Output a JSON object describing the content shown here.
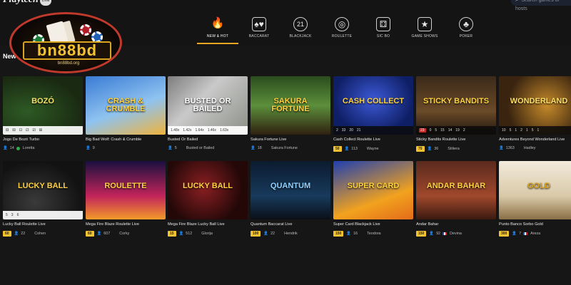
{
  "brand": {
    "name": "Playtech",
    "badge": "LIVE"
  },
  "search": {
    "placeholder": "Search games or hosts"
  },
  "logo": {
    "word": "bn88bd",
    "sub": "bn88bd.org"
  },
  "categories": [
    {
      "label": "NEW & HOT",
      "icon": "flame-icon",
      "glyph": "🔥",
      "active": true
    },
    {
      "label": "BACCARAT",
      "icon": "cards-icon",
      "glyph": "♠♥"
    },
    {
      "label": "BLACKJACK",
      "icon": "blackjack-21-icon",
      "glyph": "21"
    },
    {
      "label": "ROULETTE",
      "icon": "roulette-icon",
      "glyph": "◎"
    },
    {
      "label": "SIC BO",
      "icon": "dice-icon",
      "glyph": "⚃"
    },
    {
      "label": "GAME SHOWS",
      "icon": "game-show-icon",
      "glyph": "★"
    },
    {
      "label": "POKER",
      "icon": "poker-chip-icon",
      "glyph": "♣"
    }
  ],
  "section_title": "New",
  "row1": [
    {
      "title": "Jogo De Bozó Turbo",
      "bet": "",
      "players": "14",
      "flag": "br",
      "host": "Loretta",
      "art": "BOZÓ",
      "hist": [
        "⚃",
        "⚄",
        "⚀",
        "⚁",
        "⚂",
        "⚅"
      ]
    },
    {
      "title": "Big Bad Wolf: Crash & Crumble",
      "bet": "",
      "players": "9",
      "flag": "",
      "host": "",
      "art": "CRASH & CRUMBLE",
      "hist": []
    },
    {
      "title": "Busted Or Bailed",
      "bet": "",
      "players": "5",
      "flag": "",
      "host": "Busted or Bailed",
      "art": "BUSTED OR BAILED",
      "hist": [
        "1.48x",
        "1.42x",
        "1.64x",
        "1.46x",
        "1.63x"
      ]
    },
    {
      "title": "Sakura Fortune Live",
      "bet": "",
      "players": "18",
      "flag": "",
      "host": "Sakura Fortune",
      "art": "SAKURA FORTUNE",
      "hist": []
    },
    {
      "title": "Cash Collect Roulette Live",
      "bet": "50",
      "players": "113",
      "flag": "",
      "host": "Wayne",
      "art": "CASH COLLECT",
      "hist": [
        "2",
        "33",
        "20",
        "21"
      ]
    },
    {
      "title": "Sticky Bandits Roulette Live",
      "bet": "70",
      "players": "36",
      "flag": "",
      "host": "Stiliera",
      "art": "STICKY BANDITS",
      "hist": [
        "23",
        "0",
        "5",
        "15",
        "14",
        "19",
        "2"
      ]
    },
    {
      "title": "Adventures Beyond Wonderland Live",
      "bet": "",
      "players": "1363",
      "flag": "",
      "host": "Hadley",
      "art": "WONDERLAND",
      "hist": [
        "10",
        "5",
        "1",
        "2",
        "1",
        "5",
        "1"
      ]
    }
  ],
  "row2": [
    {
      "title": "Lucky Ball Roulette Live",
      "bet": "60",
      "players": "22",
      "flag": "",
      "host": "Cohen",
      "art": "LUCKY BALL",
      "hist": [
        "5",
        "3",
        "6"
      ]
    },
    {
      "title": "Mega Fire Blaze Roulette Live",
      "bet": "60",
      "players": "607",
      "flag": "",
      "host": "Corky",
      "art": "ROULETTE",
      "hist": []
    },
    {
      "title": "Mega Fire Blaze Lucky Ball Live",
      "bet": "15",
      "players": "512",
      "flag": "",
      "host": "Glorija",
      "art": "LUCKY BALL",
      "hist": []
    },
    {
      "title": "Quantum Baccarat Live",
      "bet": "100",
      "players": "22",
      "flag": "",
      "host": "Hendrik",
      "art": "QUANTUM",
      "hist": []
    },
    {
      "title": "Super Card Blackjack Live",
      "bet": "150",
      "players": "16",
      "flag": "",
      "host": "Teodora",
      "art": "SUPER CARD",
      "hist": []
    },
    {
      "title": "Andar Bahar",
      "bet": "150",
      "players": "92",
      "flag": "in",
      "host": "Devina",
      "art": "ANDAR BAHAR",
      "hist": []
    },
    {
      "title": "Punto Banco Sorbo Gold",
      "bet": "300",
      "players": "7",
      "flag": "it",
      "host": "Areza",
      "art": "GOLD",
      "hist": []
    }
  ],
  "colors": {
    "accent": "#f6a623",
    "bet_badge": "#f2c230",
    "logo_ring": "#c0392b"
  }
}
